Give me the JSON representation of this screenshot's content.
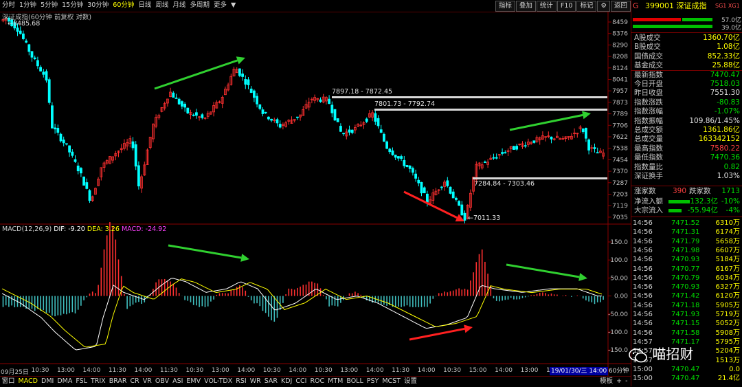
{
  "topbar": {
    "tabs": [
      "分时",
      "1分钟",
      "5分钟",
      "15分钟",
      "30分钟",
      "60分钟",
      "日线",
      "周线",
      "月线",
      "多周期",
      "更多"
    ],
    "active": "60分钟",
    "tools": [
      "指标",
      "叠加",
      "统计",
      "F10",
      "标记",
      "",
      "返回"
    ],
    "menu_arrow": "▼"
  },
  "main": {
    "title": "深证成指(60分钟 前复权 对数)",
    "high_label": "8485.68",
    "low_label": "7011.33",
    "gap1": "7897.18 - 7872.45",
    "gap2": "7801.73 - 7792.74",
    "gap3": "7284.84 - 7303.46",
    "y_ticks": [
      "8459",
      "8376",
      "8290",
      "8208",
      "8124",
      "8041",
      "7957",
      "7873",
      "7789",
      "7706",
      "7622",
      "7538",
      "7454",
      "7370",
      "7287",
      "7203",
      "7119",
      "7035"
    ]
  },
  "macd": {
    "name": "MACD(12,26,9)",
    "dif": "DIF: -9.20",
    "dea": "DEA: 3.26",
    "macd": "MACD: -24.92",
    "y_ticks": [
      "150.0",
      "100.0",
      "50.00",
      "0.00",
      "-50.00",
      "-100.0",
      "-150.0"
    ]
  },
  "xaxis": {
    "labels": [
      "09月25日",
      "10:30",
      "13:00",
      "14:00",
      "11:30",
      "14:00",
      "11:30",
      "10:30",
      "13:00",
      "14:00",
      "10:30",
      "14:00",
      "10:30",
      "13:00",
      "14:00",
      "11:30",
      "14:00",
      "10:30",
      "15:00",
      "14:00",
      "13:00",
      "14:00",
      "14:00"
    ],
    "cursor_time": "19/01/30/三 14:00",
    "period": "60分钟"
  },
  "bottombar": {
    "tabs": [
      "窗口",
      "MACD",
      "DMI",
      "DMA",
      "FSL",
      "TRIX",
      "BRAR",
      "CR",
      "VR",
      "OBV",
      "ASI",
      "EMV",
      "VOL-TDX",
      "RSI",
      "WR",
      "SAR",
      "KDJ",
      "CCI",
      "ROC",
      "MTM",
      "BOLL",
      "PSY",
      "MCST",
      "设置"
    ],
    "active": "MACD",
    "right": [
      "模板",
      "+",
      "-"
    ]
  },
  "panel": {
    "header_code": "399001",
    "header_name": "深证成指",
    "header_tag": "SG1 XG1",
    "G": "G",
    "bar_up_val": "57.0亿",
    "bar_dn_val": "39.0亿",
    "stats": [
      {
        "label": "A股成交",
        "value": "1360.70亿",
        "cls": "yl"
      },
      {
        "label": "B股成交",
        "value": "1.08亿",
        "cls": "yl"
      },
      {
        "label": "国债成交",
        "value": "852.33亿",
        "cls": "yl"
      },
      {
        "label": "基金成交",
        "value": "25.88亿",
        "cls": "yl"
      },
      {
        "label": "最新指数",
        "value": "7470.47",
        "cls": "dn"
      },
      {
        "label": "今日开盘",
        "value": "7518.03",
        "cls": "dn"
      },
      {
        "label": "昨日收盘",
        "value": "7551.30",
        "cls": "wh"
      },
      {
        "label": "指数涨跌",
        "value": "-80.83",
        "cls": "dn"
      },
      {
        "label": "指数涨幅",
        "value": "-1.07%",
        "cls": "dn"
      },
      {
        "label": "指数振幅",
        "value": "109.86/1.45%",
        "cls": "wh"
      },
      {
        "label": "总成交额",
        "value": "1361.86亿",
        "cls": "yl"
      },
      {
        "label": "总成交量",
        "value": "163342152",
        "cls": "yl"
      },
      {
        "label": "最高指数",
        "value": "7580.22",
        "cls": "up"
      },
      {
        "label": "最低指数",
        "value": "7470.36",
        "cls": "dn"
      },
      {
        "label": "指数量比",
        "value": "0.82",
        "cls": "dn"
      },
      {
        "label": "深证换手",
        "value": "1.03%",
        "cls": "wh"
      }
    ],
    "updown": {
      "up_label": "涨家数",
      "up": "390",
      "dn_label": "跌家数",
      "dn": "1713"
    },
    "flow": [
      {
        "label": "净流入额",
        "value": "-132.3亿",
        "pct": "-10%",
        "bar": 0.62
      },
      {
        "label": "大宗流入",
        "value": "-55.94亿",
        "pct": "-4%",
        "bar": 0.38
      }
    ],
    "ticks": [
      {
        "t": "14:56",
        "p": "7471.52",
        "v": "6310万"
      },
      {
        "t": "14:56",
        "p": "7471.31",
        "v": "6174万"
      },
      {
        "t": "14:56",
        "p": "7471.79",
        "v": "5658万"
      },
      {
        "t": "14:56",
        "p": "7471.98",
        "v": "6607万"
      },
      {
        "t": "14:56",
        "p": "7470.93",
        "v": "5184万"
      },
      {
        "t": "14:56",
        "p": "7470.77",
        "v": "6167万"
      },
      {
        "t": "14:56",
        "p": "7470.79",
        "v": "6034万"
      },
      {
        "t": "14:56",
        "p": "7470.93",
        "v": "6327万"
      },
      {
        "t": "14:56",
        "p": "7471.42",
        "v": "6120万"
      },
      {
        "t": "14:56",
        "p": "7471.18",
        "v": "5905万"
      },
      {
        "t": "14:56",
        "p": "7471.93",
        "v": "5719万"
      },
      {
        "t": "14:56",
        "p": "7471.15",
        "v": "5052万"
      },
      {
        "t": "14:56",
        "p": "7471.58",
        "v": "5908万"
      },
      {
        "t": "14:57",
        "p": "7471.17",
        "v": "5795万"
      },
      {
        "t": "14:57",
        "p": "",
        "v": "5204万"
      },
      {
        "t": "14:57",
        "p": "",
        "v": "1513万"
      },
      {
        "t": "15:00",
        "p": "7470.47",
        "v": "0.0"
      },
      {
        "t": "15:00",
        "p": "7470.47",
        "v": "21.4亿"
      }
    ],
    "watermark": "喵招财"
  }
}
